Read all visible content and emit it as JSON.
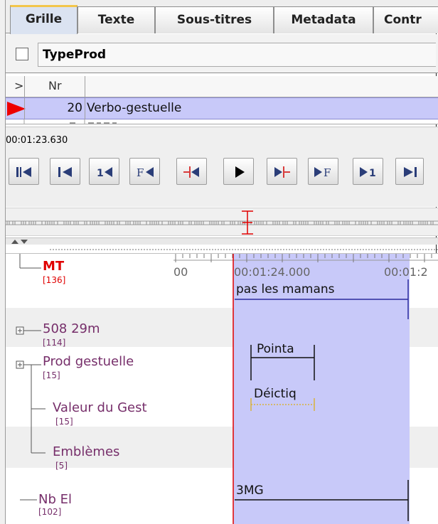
{
  "tabs": [
    {
      "label": "Grille",
      "active": true
    },
    {
      "label": "Texte",
      "active": false
    },
    {
      "label": "Sous-titres",
      "active": false
    },
    {
      "label": "Metadata",
      "active": false
    },
    {
      "label": "Contr",
      "active": false
    }
  ],
  "grid_tier": {
    "name": "TypeProd",
    "checked": false
  },
  "grid_table": {
    "headers": {
      "marker": ">",
      "nr": "Nr"
    },
    "selected_row": {
      "nr": "20",
      "annotation": "Verbo-gestuelle"
    }
  },
  "media": {
    "current_time": "00:01:23.630",
    "buttons": [
      "go-to-begin",
      "previous-frame-group",
      "step-one-back",
      "frame-back",
      "previous-boundary",
      "play",
      "next-boundary",
      "frame-forward",
      "step-one-forward",
      "next-frame-group"
    ],
    "button_labels": {
      "one_back": "1",
      "frame_back": "F",
      "frame_forward": "F",
      "one_forward": "1"
    }
  },
  "timeline": {
    "ruler": {
      "left_partial": "00",
      "time1": "00:01:24.000",
      "time2": "00:01:2"
    },
    "tiers": [
      {
        "name": "MT",
        "count": "[136]",
        "active": true
      },
      {
        "name": "508 29m",
        "count": "[114]",
        "expandable": true
      },
      {
        "name": "Prod gestuelle",
        "count": "[15]",
        "expandable": true
      },
      {
        "name": "Valeur du Gest",
        "count": "[15]"
      },
      {
        "name": "Emblèmes",
        "count": "[5]"
      },
      {
        "name": "Nb El",
        "count": "[102]"
      }
    ],
    "annotations": {
      "a1": "pas les mamans",
      "a2": "Pointa",
      "a3": "Déictiq",
      "a4": "3MG"
    }
  },
  "colors": {
    "selection": "#c8c9f9",
    "tier_name": "#762e6a",
    "active_tier": "#e00000",
    "crosshair": "#e00000",
    "tab_highlight": "#f3c64b"
  }
}
